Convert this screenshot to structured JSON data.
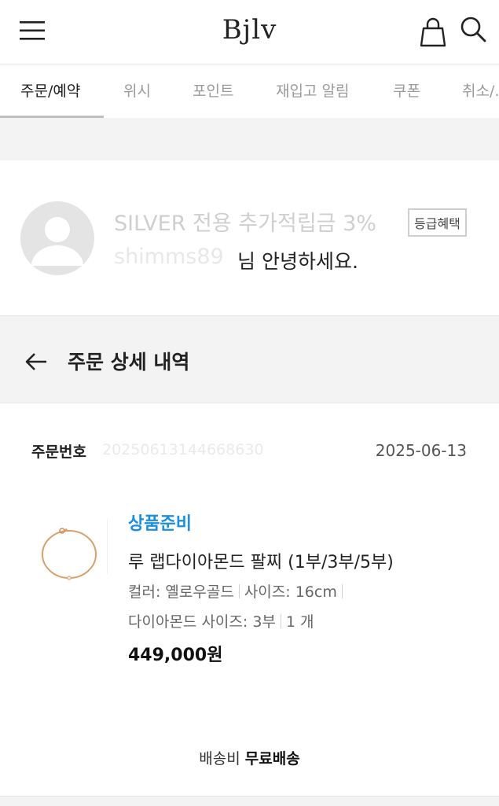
{
  "header": {
    "logo": "Bjlv",
    "menu_icon": "hamburger-menu-icon",
    "bag_icon": "shopping-bag-icon",
    "search_icon": "search-icon"
  },
  "tabs": [
    {
      "label": "주문/예약",
      "active": true
    },
    {
      "label": "위시"
    },
    {
      "label": "포인트"
    },
    {
      "label": "재입고 알림"
    },
    {
      "label": "쿠폰"
    },
    {
      "label": "취소/..."
    }
  ],
  "profile": {
    "grade_text": "SILVER 전용 추가적립금 3%",
    "grade_badge": "등급혜택",
    "user_name": "shimms89",
    "greeting": "님 안녕하세요."
  },
  "section": {
    "title": "주문 상세 내역"
  },
  "order": {
    "number_label": "주문번호",
    "number_value": "20250613144668630",
    "date": "2025-06-13",
    "status": "상품준비",
    "product_name": "루 랩다이아몬드 팔찌 (1부/3부/5부)",
    "color_option": "컬러: 옐로우골드",
    "size_option": "사이즈: 16cm",
    "diamond_option": "다이아몬드 사이즈: 3부",
    "quantity": "1 개",
    "price": "449,000원"
  },
  "shipping": {
    "label": "배송비",
    "value": "무료배송"
  },
  "colors": {
    "accent_blue": "#1a8fe0",
    "background_gray": "#f3f3f4"
  }
}
